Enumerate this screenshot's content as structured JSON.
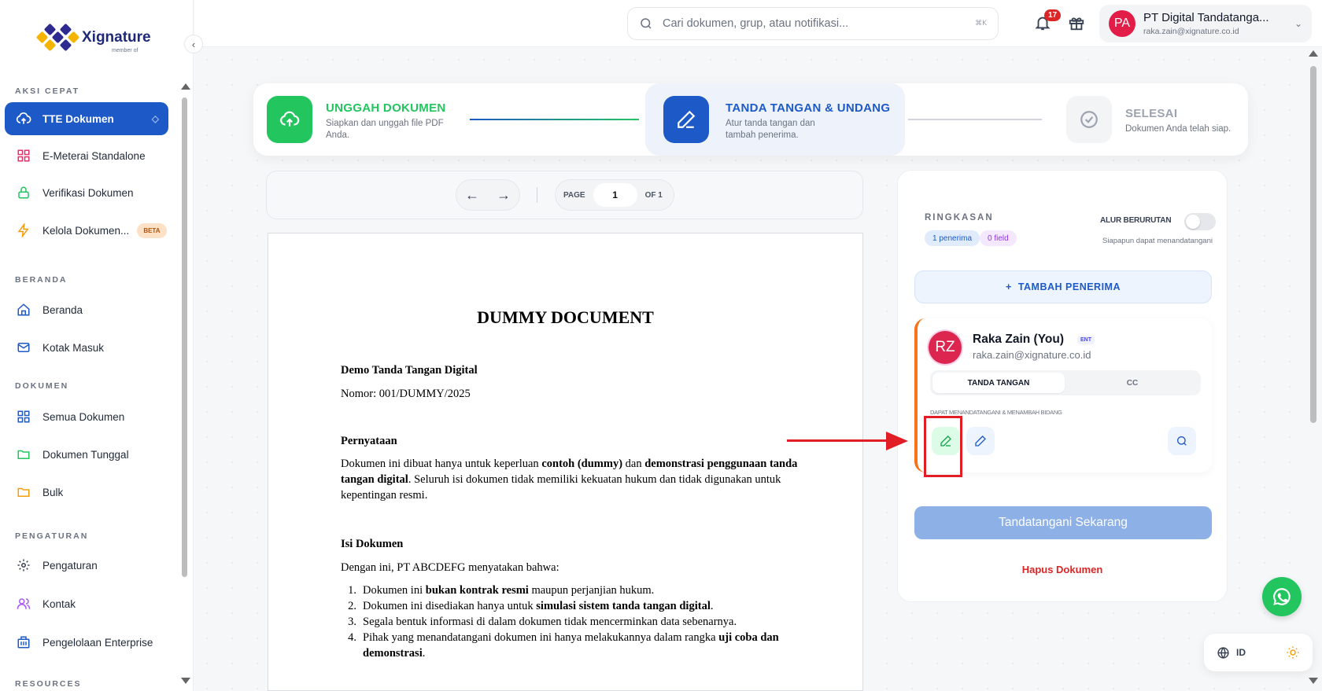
{
  "app": {
    "logo_text": "Xignature",
    "logo_sub": "member of"
  },
  "sidebar": {
    "sections": {
      "quick": "AKSI CEPAT",
      "home": "BERANDA",
      "docs": "DOKUMEN",
      "settings": "PENGATURAN",
      "resources": "RESOURCES"
    },
    "items": {
      "tte": "TTE Dokumen",
      "emeterai": "E-Meterai Standalone",
      "verify": "Verifikasi Dokumen",
      "manage": "Kelola Dokumen...",
      "manage_badge": "BETA",
      "home": "Beranda",
      "inbox": "Kotak Masuk",
      "all_docs": "Semua Dokumen",
      "single_docs": "Dokumen Tunggal",
      "bulk": "Bulk",
      "settings": "Pengaturan",
      "contacts": "Kontak",
      "enterprise": "Pengelolaan Enterprise"
    }
  },
  "topbar": {
    "search_placeholder": "Cari dokumen, grup, atau notifikasi...",
    "search_shortcut": "⌘K",
    "notif_count": "17",
    "account_initials": "PA",
    "account_name": "PT Digital Tandatanga...",
    "account_email": "raka.zain@xignature.co.id"
  },
  "stepper": {
    "step1_title": "UNGGAH DOKUMEN",
    "step1_desc": "Siapkan dan unggah file PDF Anda.",
    "step2_title": "TANDA TANGAN & UNDANG",
    "step2_desc": "Atur tanda tangan dan tambah penerima.",
    "step3_title": "SELESAI",
    "step3_desc": "Dokumen Anda telah siap."
  },
  "doc_toolbar": {
    "page_label": "PAGE",
    "page_value": "1",
    "page_of": "OF 1"
  },
  "document": {
    "title": "DUMMY DOCUMENT",
    "subtitle": "Demo Tanda Tangan Digital",
    "number": "Nomor: 001/DUMMY/2025",
    "h_statement": "Pernyataan",
    "statement_a": "Dokumen ini dibuat hanya untuk keperluan ",
    "statement_b": "contoh (dummy)",
    "statement_c": " dan ",
    "statement_d": "demonstrasi penggunaan tanda tangan digital",
    "statement_e": ". Seluruh isi dokumen tidak memiliki kekuatan hukum dan tidak digunakan untuk kepentingan resmi.",
    "h_content": "Isi Dokumen",
    "content_intro": "Dengan ini, PT ABCDEFG menyatakan bahwa:",
    "list": [
      {
        "num": "1.",
        "a": "Dokumen ini ",
        "b": "bukan kontrak resmi",
        "c": " maupun perjanjian hukum."
      },
      {
        "num": "2.",
        "a": "Dokumen ini disediakan hanya untuk ",
        "b": "simulasi sistem tanda tangan digital",
        "c": "."
      },
      {
        "num": "3.",
        "a": "Segala bentuk informasi di dalam dokumen tidak mencerminkan data sebenarnya.",
        "b": "",
        "c": ""
      },
      {
        "num": "4.",
        "a": "Pihak yang menandatangani dokumen ini hanya melakukannya dalam rangka ",
        "b": "uji coba dan demonstrasi",
        "c": "."
      }
    ]
  },
  "panel": {
    "summary_label": "RINGKASAN",
    "chip_recipients": "1 penerima",
    "chip_fields": "0 field",
    "sequential_label": "ALUR BERURUTAN",
    "sequential_desc": "Siapapun dapat menandatangani",
    "add_recipient": "TAMBAH PENERIMA",
    "recipient_initials": "RZ",
    "recipient_name": "Raka Zain (You)",
    "recipient_badge": "ENT",
    "recipient_email": "raka.zain@xignature.co.id",
    "role_sign": "TANDA TANGAN",
    "role_cc": "CC",
    "role_desc": "DAPAT MENANDATANGANI & MENAMBAH BIDANG",
    "sign_now": "Tandatangani Sekarang",
    "delete_doc": "Hapus Dokumen"
  },
  "floating": {
    "lang": "ID"
  },
  "colors": {
    "primary": "#1d5ac7",
    "success": "#22c55e",
    "danger": "#dc2626",
    "accent_orange": "#f97316"
  }
}
